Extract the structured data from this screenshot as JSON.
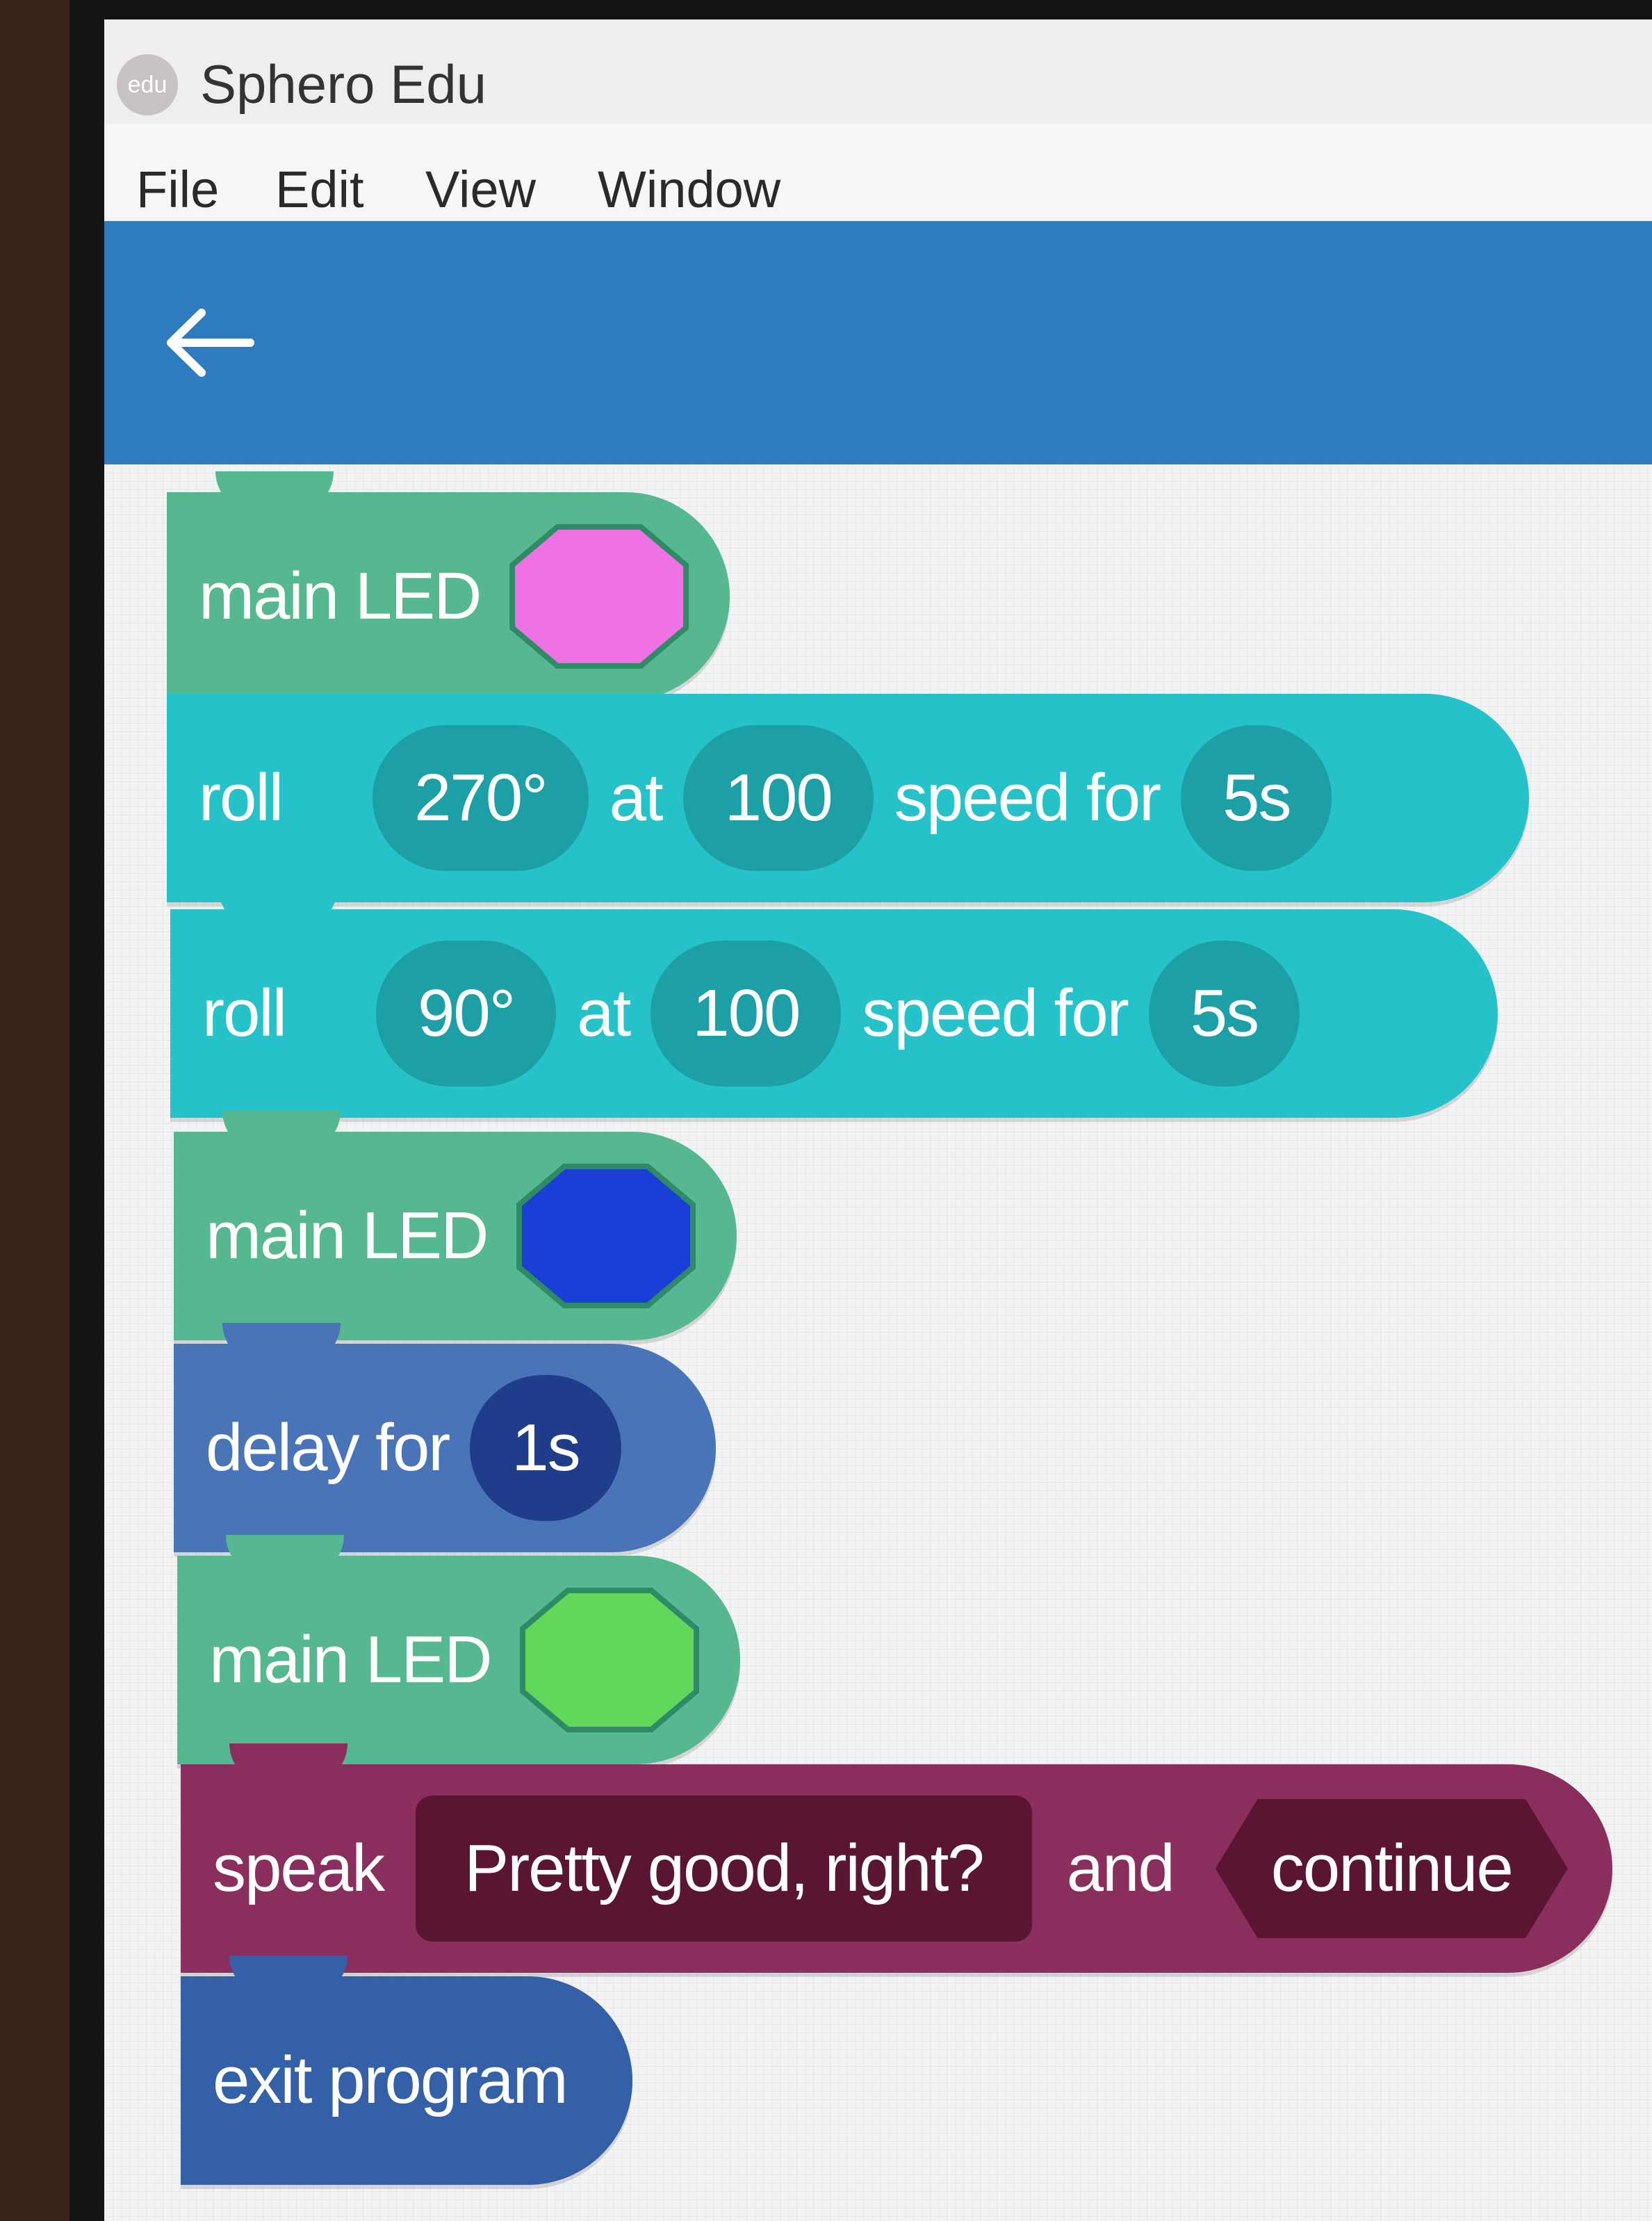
{
  "app": {
    "title": "Sphero Edu",
    "logo_text": "edu"
  },
  "menu": [
    "File",
    "Edit",
    "View",
    "Window"
  ],
  "blocks": {
    "led1": {
      "label": "main LED",
      "color": "#ef72e4"
    },
    "roll1": {
      "label": "roll",
      "heading": "270°",
      "at": "at",
      "speed": "100",
      "speed_for": "speed for",
      "duration": "5s"
    },
    "roll2": {
      "label": "roll",
      "heading": "90°",
      "at": "at",
      "speed": "100",
      "speed_for": "speed for",
      "duration": "5s"
    },
    "led2": {
      "label": "main LED",
      "color": "#1a3fd6"
    },
    "delay": {
      "label": "delay for",
      "duration": "1s"
    },
    "led3": {
      "label": "main LED",
      "color": "#62d85a"
    },
    "speak": {
      "label": "speak",
      "text": "Pretty good, right?",
      "and": "and",
      "mode": "continue"
    },
    "exit": {
      "label": "exit program"
    }
  },
  "colors": {
    "accent_bar": "#2e7bc0",
    "led_block": "#56b890",
    "roll_block": "#25c2c9",
    "delay_block": "#4a74b8",
    "speak_block": "#8a2e5e",
    "exit_block": "#3460a8"
  }
}
